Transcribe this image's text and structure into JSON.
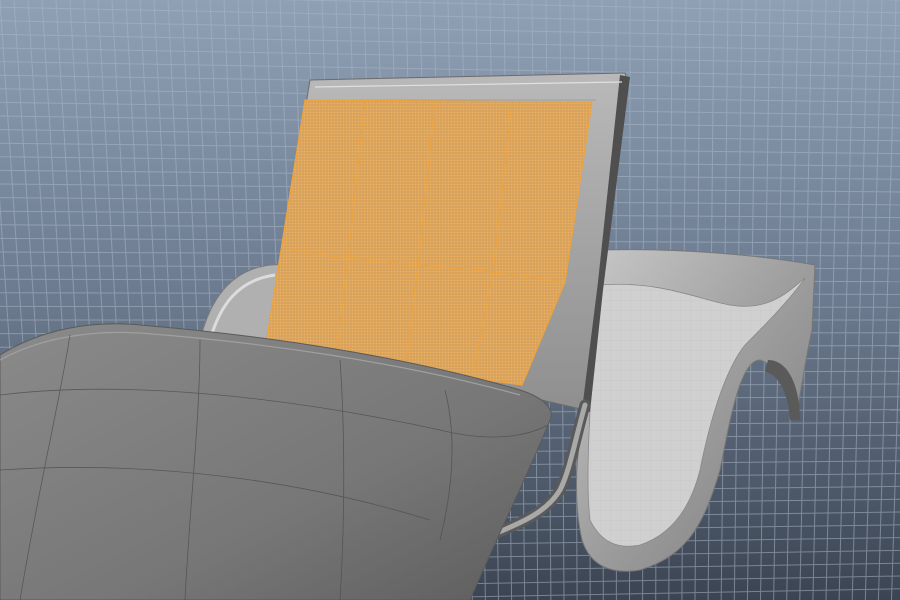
{
  "viewport": {
    "background_top": "#8a9bb0",
    "background_bottom": "#3e4756",
    "grid_color": "#a7b4c5",
    "model_color": "#8c8c8c",
    "model_dark": "#6e6e6e",
    "selection_color": "#f0a33a",
    "hud_label": ""
  }
}
